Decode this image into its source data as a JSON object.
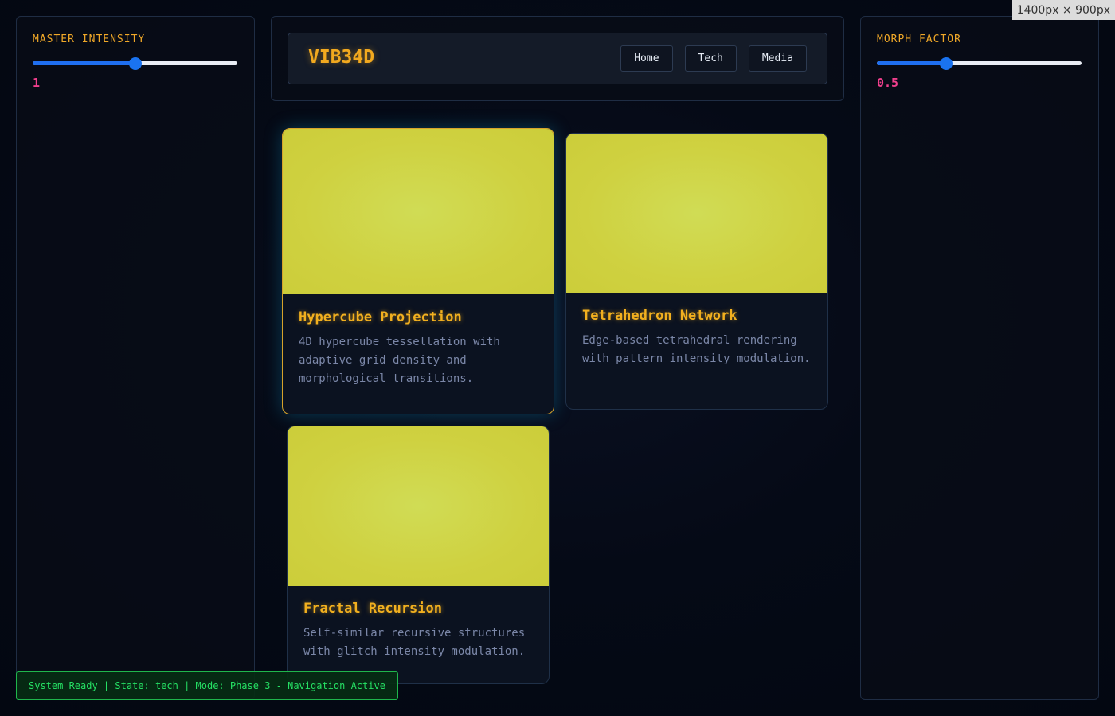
{
  "controls": {
    "left": {
      "label": "MASTER INTENSITY",
      "value": "1",
      "fraction": 0.5
    },
    "right": {
      "label": "MORPH FACTOR",
      "value": "0.5",
      "fraction": 0.34
    }
  },
  "header": {
    "brand": "VIB34D",
    "nav": [
      "Home",
      "Tech",
      "Media"
    ]
  },
  "cards": [
    {
      "title": "Hypercube Projection",
      "description": "4D hypercube tessellation with adaptive grid density and morphological transitions.",
      "active": true
    },
    {
      "title": "Tetrahedron Network",
      "description": "Edge-based tetrahedral rendering with pattern intensity modulation.",
      "active": false
    },
    {
      "title": "Fractal Recursion",
      "description": "Self-similar recursive structures with glitch intensity modulation.",
      "active": false
    }
  ],
  "status": "System Ready | State: tech | Mode: Phase 3 - Navigation Active",
  "dimension_tag": "1400px × 900px",
  "colors": {
    "accent": "#f2a91f",
    "value": "#ef3f8c",
    "slider": "#1f6ff0",
    "card_visual": "#cfd140",
    "status": "#25e064"
  }
}
